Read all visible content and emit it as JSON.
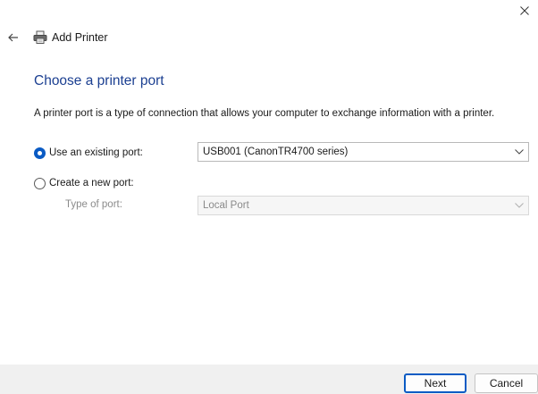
{
  "window": {
    "close_icon": "close-icon"
  },
  "header": {
    "back_icon": "back-arrow-icon",
    "printer_icon": "printer-icon",
    "title": "Add Printer"
  },
  "main": {
    "heading": "Choose a printer port",
    "description": "A printer port is a type of connection that allows your computer to exchange information with a printer.",
    "existing_port": {
      "label": "Use an existing port:",
      "checked": true,
      "selected_value": "USB001 (CanonTR4700 series)"
    },
    "new_port": {
      "label": "Create a new port:",
      "checked": false,
      "type_label": "Type of port:",
      "selected_value": "Local Port"
    }
  },
  "footer": {
    "next_label": "Next",
    "cancel_label": "Cancel"
  },
  "colors": {
    "accent": "#0a5bc4",
    "heading": "#1b3f91",
    "footer_bg": "#f0f0f0"
  }
}
